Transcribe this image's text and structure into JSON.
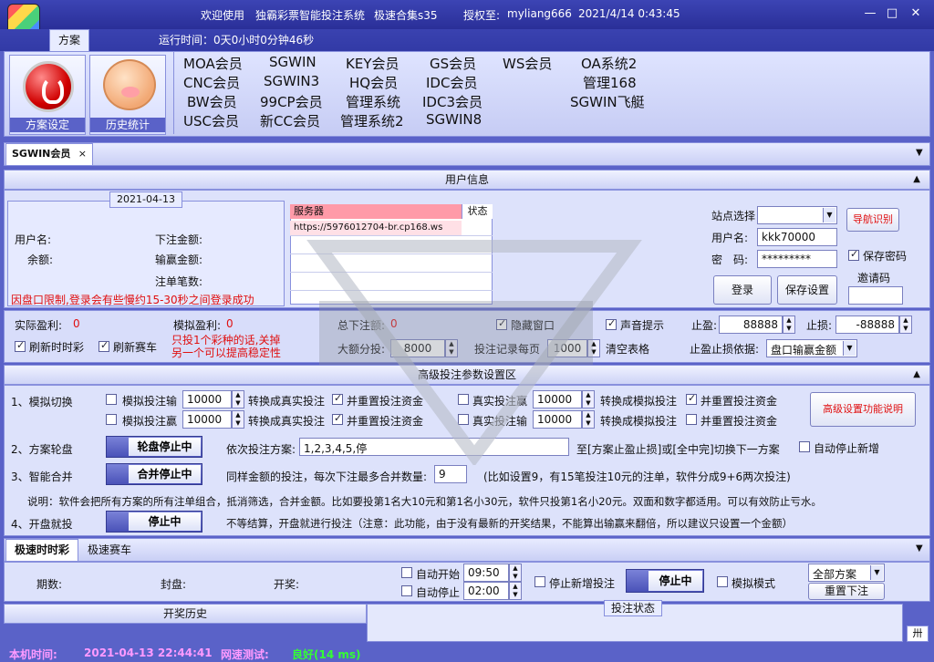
{
  "titlebar": {
    "welcome": "欢迎使用",
    "app_name": "独霸彩票智能投注系统",
    "edition": "极速合集s35",
    "licensed_label": "授权至:",
    "licensed_user": "myliang666",
    "datetime": "2021/4/14 0:43:45",
    "minimize": "—",
    "maximize": "□",
    "close": "✕"
  },
  "tab_scheme": "方案",
  "runtime": "运行时间：0天0小时0分钟46秒",
  "ribbon": {
    "btn1": "方案设定",
    "btn2": "历史统计",
    "links": [
      "MOA会员",
      "SGWIN",
      "KEY会员",
      "GS会员",
      "WS会员",
      "OA系统2",
      "CNC会员",
      "SGWIN3",
      "HQ会员",
      "IDC会员",
      "管理168",
      "BW会员",
      "99CP会员",
      "管理系统",
      "IDC3会员",
      "SGWIN飞艇",
      "USC会员",
      "新CC会员",
      "管理系统2",
      "SGWIN8"
    ]
  },
  "doc_tab": {
    "label": "SGWIN会员",
    "close": "×"
  },
  "doc_dropdown": "▼",
  "user_info": {
    "title": "用户信息",
    "caret": "▲",
    "date": "2021-04-13",
    "username_label": "用户名:",
    "balance_label": "余额:",
    "bet_amount_label": "下注金额:",
    "winloss_label": "输赢金额:",
    "bet_count_label": "注单笔数:",
    "notice": "因盘口限制,登录会有些慢约15-30秒之间登录成功",
    "grid_col1": "服务器",
    "grid_col2": "状态",
    "grid_row1": "https://5976012704-br.cp168.ws",
    "site_label": "站点选择",
    "nav_button": "导航识别",
    "user_label": "用户名:",
    "user_value": "kkk70000",
    "pwd_label": "密　码:",
    "pwd_value": "*********",
    "save_pwd": "保存密码",
    "invite_label": "邀请码",
    "login": "登录",
    "save_settings": "保存设置"
  },
  "stats": {
    "real_profit_label": "实际盈利:",
    "real_profit": "0",
    "sim_profit_label": "模拟盈利:",
    "sim_profit": "0",
    "total_bets_label": "总下注额:",
    "total_bets": "0",
    "hide_window": "隐藏窗口",
    "sound": "声音提示",
    "take_profit_label": "止盈:",
    "take_profit": "88888",
    "stop_loss_label": "止损:",
    "stop_loss": "-88888",
    "refresh_fast": "刷新时时彩",
    "refresh_race": "刷新赛车",
    "warn1": "只投1个彩种的话,关掉",
    "warn2": "另一个可以提高稳定性",
    "max_bet_label": "大额分投:",
    "max_bet": "8000",
    "split_label": "投注记录每页",
    "split": "1000",
    "clear_table": "清空表格",
    "basis_label": "止盈止损依据:",
    "basis_value": "盘口输赢金额"
  },
  "advanced": {
    "title": "高级投注参数设置区",
    "caret": "▲",
    "row1_label": "1、模拟切换",
    "sim_lose": "模拟投注输",
    "sim_win": "模拟投注赢",
    "real_win": "真实投注赢",
    "real_lose": "真实投注输",
    "amount": "10000",
    "to_real": "转换成真实投注",
    "to_sim": "转换成模拟投注",
    "reset": "并重置投注资金",
    "explain_btn": "高级设置功能说明",
    "row2_label": "2、方案轮盘",
    "wheel_btn": "轮盘停止中",
    "order_label": "依次投注方案:",
    "order_value": "1,2,3,4,5,停",
    "order_suffix": "至[方案止盈止损]或[全中完]切换下一方案",
    "auto_stop": "自动停止新增",
    "row3_label": "3、智能合并",
    "merge_btn": "合并停止中",
    "merge_text": "同样金额的投注，每次下注最多合并数量:",
    "merge_value": "9",
    "merge_hint": "(比如设置9，有15笔投注10元的注单，软件分成9+6两次投注)",
    "explain": "说明：软件会把所有方案的所有注单组合，抵消筛选，合并金额。比如要投第1名大10元和第1名小30元，软件只投第1名小20元。双面和数字都适用。可以有效防止亏水。",
    "row4_label": "4、开盘就投",
    "open_btn": "停止中",
    "open_text": "不等结算，开盘就进行投注（注意：此功能，由于没有最新的开奖结果，不能算出输赢来翻倍，所以建议只设置一个金额）"
  },
  "bottom_tabs": [
    "极速时时彩",
    "极速赛车"
  ],
  "bottom_dropdown": "▼",
  "draw": {
    "period_label": "期数:",
    "close_label": "封盘:",
    "draw_label": "开奖:",
    "auto_start": "自动开始",
    "auto_start_time": "09:50",
    "auto_stop": "自动停止",
    "auto_stop_time": "02:00",
    "stop_new": "停止新增投注",
    "running_btn": "停止中",
    "sim_mode": "模拟模式",
    "scheme_select": "全部方案",
    "rebet": "重置下注"
  },
  "history_label": "开奖历史",
  "bet_status_label": "投注状态",
  "grid_icon": "卅",
  "statusbar": {
    "local_time_label": "本机时间:",
    "local_time": "2021-04-13 22:44:41",
    "net_label": "网速测试:",
    "net_value": "良好(14 ms)"
  },
  "colors": {
    "accent": "#5a62c8",
    "warning": "#e01010",
    "good": "#22dd22"
  }
}
